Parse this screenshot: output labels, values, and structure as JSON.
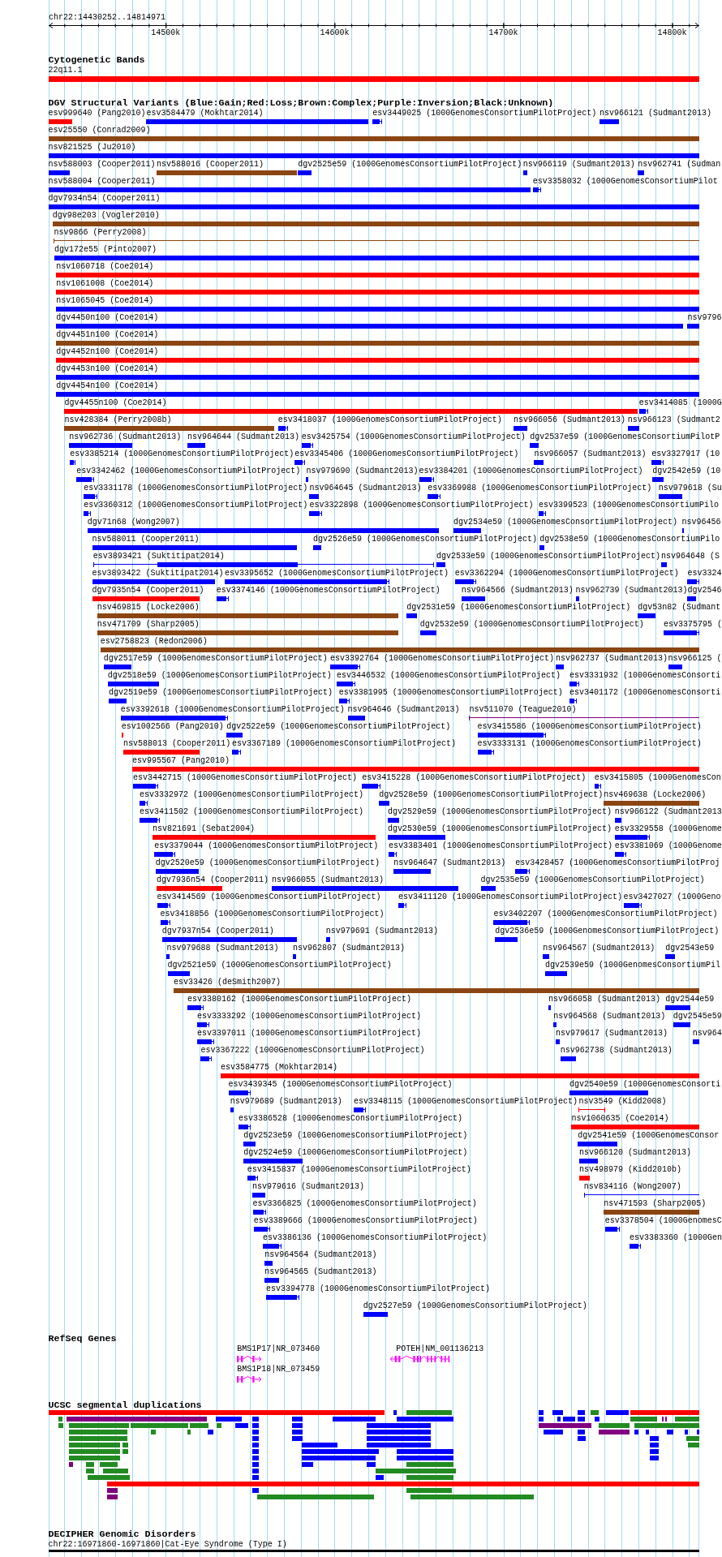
{
  "ruler": {
    "range": "chr22:14430252..14814971",
    "ticks": [
      "14500k",
      "14600k",
      "14700k",
      "14800k"
    ]
  },
  "tracks": [
    {
      "kind": "cytoband",
      "title": "Cytogenetic Bands",
      "bands": [
        {
          "label": "22q11.1"
        }
      ]
    },
    {
      "kind": "variants",
      "title": "DGV Structural Variants (Blue:Gain;Red:Loss;Brown:Complex;Purple:Inversion;Black:Unknown)",
      "rows": [
        {
          "features": [
            {
              "label": "esv999640 (Pang2010)",
              "color": "#ff0000",
              "kind": "solid"
            },
            {
              "label": "esv3584479 (Mokhtar2014)",
              "color": "#0000ff",
              "kind": "solid"
            },
            {
              "label": "esv3449025 (1000GenomesConsortiumPilotProject)",
              "color": "#0000ff",
              "kind": "bracketed"
            },
            {
              "label": "nsv966121 (Sudmant2013)",
              "color": "#0000ff",
              "kind": "solid"
            }
          ]
        },
        {
          "features": [
            {
              "label": "esv25550 (Conrad2009)",
              "color": "#8b4513",
              "kind": "solid"
            }
          ]
        },
        {
          "features": [
            {
              "label": "nsv821525 (Ju2010)",
              "color": "#0000ff",
              "kind": "solid"
            }
          ]
        },
        {
          "features": [
            {
              "label": "nsv588003 (Cooper2011)",
              "color": "#0000ff",
              "kind": "solid"
            },
            {
              "label": "nsv588016 (Cooper2011)",
              "color": "#8b4513",
              "kind": "solid"
            },
            {
              "label": "dgv2525e59 (1000GenomesConsortiumPilotProject)",
              "color": "#0000ff",
              "kind": "solid"
            },
            {
              "label": "nsv966119 (Sudmant2013)",
              "color": "#0000ff",
              "kind": "solid"
            },
            {
              "label": "nsv962741 (Sudman",
              "color": "#0000ff",
              "kind": "solid"
            }
          ]
        },
        {
          "features": [
            {
              "label": "nsv588004 (Cooper2011)",
              "color": "#0000ff",
              "kind": "solid"
            },
            {
              "label": "esv3358032 (1000GenomesConsortiumPilot",
              "color": "#0000ff",
              "kind": "bracketed"
            }
          ]
        },
        {
          "features": [
            {
              "label": "dgv7934n54 (Cooper2011)",
              "color": "#0000ff",
              "kind": "solid"
            }
          ]
        },
        {
          "features": [
            {
              "label": "dgv98e203 (Vogler2010)",
              "color": "#8b4513",
              "kind": "solid"
            }
          ]
        },
        {
          "features": [
            {
              "label": "nsv9866 (Perry2008)",
              "color": "#8b4513",
              "kind": "line"
            }
          ]
        },
        {
          "features": [
            {
              "label": "dgv172e55 (Pinto2007)",
              "color": "#0000ff",
              "kind": "solid"
            }
          ]
        },
        {
          "features": [
            {
              "label": "nsv1060718 (Coe2014)",
              "color": "#ff0000",
              "kind": "solid"
            }
          ]
        },
        {
          "features": [
            {
              "label": "nsv1061008 (Coe2014)",
              "color": "#ff0000",
              "kind": "solid"
            }
          ]
        },
        {
          "features": [
            {
              "label": "nsv1065045 (Coe2014)",
              "color": "#0000ff",
              "kind": "solid"
            }
          ]
        },
        {
          "features": [
            {
              "label": "dgv4450n100 (Coe2014)",
              "color": "#0000ff",
              "kind": "solid"
            },
            {
              "label": "nsv9796",
              "color": "#0000ff",
              "kind": "solid"
            }
          ]
        },
        {
          "features": [
            {
              "label": "dgv4451n100 (Coe2014)",
              "color": "#8b4513",
              "kind": "solid"
            }
          ]
        },
        {
          "features": [
            {
              "label": "dgv4452n100 (Coe2014)",
              "color": "#ff0000",
              "kind": "solid"
            }
          ]
        },
        {
          "features": [
            {
              "label": "dgv4453n100 (Coe2014)",
              "color": "#0000ff",
              "kind": "solid"
            }
          ]
        },
        {
          "features": [
            {
              "label": "dgv4454n100 (Coe2014)",
              "color": "#0000ff",
              "kind": "solid"
            }
          ]
        },
        {
          "features": [
            {
              "label": "dgv4455n100 (Coe2014)",
              "color": "#ff0000",
              "kind": "solid"
            },
            {
              "label": "esv3414085 (1000G",
              "color": "#0000ff",
              "kind": "bracketed"
            }
          ]
        },
        {
          "features": [
            {
              "label": "nsv428384 (Perry2008b)",
              "color": "#8b4513",
              "kind": "solid"
            },
            {
              "label": "esv3418037 (1000GenomesConsortiumPilotProject)",
              "color": "#0000ff",
              "kind": "bracketed"
            },
            {
              "label": "nsv966056 (Sudmant2013)",
              "color": "#0000ff",
              "kind": "solid"
            },
            {
              "label": "nsv966123 (Sudmant2",
              "color": "#0000ff",
              "kind": "solid"
            }
          ]
        },
        {
          "features": [
            {
              "label": "nsv962736 (Sudmant2013)",
              "color": "#0000ff",
              "kind": "solid"
            },
            {
              "label": "nsv964644 (Sudmant2013)",
              "color": "#0000ff",
              "kind": "solid"
            },
            {
              "label": "esv3425754 (1000GenomesConsortiumPilotProject)",
              "color": "#0000ff",
              "kind": "bracketed"
            },
            {
              "label": "dgv2537e59 (1000GenomesConsortiumPilotP",
              "color": "#0000ff",
              "kind": "solid"
            }
          ]
        },
        {
          "features": [
            {
              "label": "esv3385214 (1000GenomesConsortiumPilotProject)",
              "color": "#0000ff",
              "kind": "bracketed"
            },
            {
              "label": "esv3345406 (1000GenomesConsortiumPilotProject)",
              "color": "#0000ff",
              "kind": "bracketed"
            },
            {
              "label": "nsv966057 (Sudmant2013)",
              "color": "#0000ff",
              "kind": "solid"
            },
            {
              "label": "esv3327917 (10",
              "color": "#0000ff",
              "kind": "bracketed"
            }
          ]
        },
        {
          "features": [
            {
              "label": "esv3342462 (1000GenomesConsortiumPilotProject)",
              "color": "#0000ff",
              "kind": "bracketed"
            },
            {
              "label": "nsv979690 (Sudmant2013)",
              "color": "#0000ff",
              "kind": "solid"
            },
            {
              "label": "esv3384201 (1000GenomesConsortiumPilotProject)",
              "color": "#0000ff",
              "kind": "bracketed"
            },
            {
              "label": "dgv2542e59 (10",
              "color": "#0000ff",
              "kind": "solid"
            }
          ]
        },
        {
          "features": [
            {
              "label": "esv3331178 (1000GenomesConsortiumPilotProject)",
              "color": "#0000ff",
              "kind": "bracketed"
            },
            {
              "label": "nsv964645 (Sudmant2013)",
              "color": "#0000ff",
              "kind": "solid"
            },
            {
              "label": "esv3369988 (1000GenomesConsortiumPilotProject)",
              "color": "#0000ff",
              "kind": "bracketed"
            },
            {
              "label": "nsv979618 (Su",
              "color": "#0000ff",
              "kind": "solid"
            }
          ]
        },
        {
          "features": [
            {
              "label": "esv3360312 (1000GenomesConsortiumPilotProject)",
              "color": "#0000ff",
              "kind": "bracketed"
            },
            {
              "label": "esv3322898 (1000GenomesConsortiumPilotProject)",
              "color": "#0000ff",
              "kind": "bracketed"
            },
            {
              "label": "esv3399523 (1000GenomesConsortiumPilo",
              "color": "#0000ff",
              "kind": "bracketed"
            }
          ]
        },
        {
          "features": [
            {
              "label": "dgv71n68 (Wong2007)",
              "color": "#0000ff",
              "kind": "solid"
            },
            {
              "label": "dgv2534e59 (1000GenomesConsortiumPilotProject)",
              "color": "#0000ff",
              "kind": "solid"
            },
            {
              "label": "nsv96456",
              "color": "#0000ff",
              "kind": "solid"
            }
          ]
        },
        {
          "features": [
            {
              "label": "nsv588011 (Cooper2011)",
              "color": "#0000ff",
              "kind": "solid"
            },
            {
              "label": "dgv2526e59 (1000GenomesConsortiumPilotProject)",
              "color": "#0000ff",
              "kind": "solid"
            },
            {
              "label": "dgv2538e59 (1000GenomesConsortiumPilo",
              "color": "#0000ff",
              "kind": "solid"
            }
          ]
        },
        {
          "features": [
            {
              "label": "esv3893421 (Suktitipat2014)",
              "color": "#0000ff",
              "kind": "cored"
            },
            {
              "label": "dgv2533e59 (1000GenomesConsortiumPilotProject)",
              "color": "#0000ff",
              "kind": "solid"
            },
            {
              "label": "nsv964648 (S",
              "color": "#0000ff",
              "kind": "solid"
            }
          ]
        },
        {
          "features": [
            {
              "label": "esv3893422 (Suktitipat2014)",
              "color": "#0000ff",
              "kind": "solid"
            },
            {
              "label": "esv3395652 (1000GenomesConsortiumPilotProject)",
              "color": "#0000ff",
              "kind": "bracketed"
            },
            {
              "label": "esv3362294 (1000GenomesConsortiumPilotProject)",
              "color": "#0000ff",
              "kind": "bracketed"
            },
            {
              "label": "esv3324",
              "color": "#0000ff",
              "kind": "bracketed"
            }
          ]
        },
        {
          "features": [
            {
              "label": "dgv7935n54 (Cooper2011)",
              "color": "#ff0000",
              "kind": "solid"
            },
            {
              "label": "esv3374146 (1000GenomesConsortiumPilotProject)",
              "color": "#0000ff",
              "kind": "bracketed"
            },
            {
              "label": "nsv964566 (Sudmant2013)",
              "color": "#0000ff",
              "kind": "solid"
            },
            {
              "label": "nsv962739 (Sudmant2013)",
              "color": "#0000ff",
              "kind": "solid"
            },
            {
              "label": "dgv2546",
              "color": "#0000ff",
              "kind": "solid"
            }
          ]
        },
        {
          "features": [
            {
              "label": "nsv469815 (Locke2006)",
              "color": "#8b4513",
              "kind": "solid"
            },
            {
              "label": "dgv2531e59 (1000GenomesConsortiumPilotProject)",
              "color": "#0000ff",
              "kind": "solid"
            },
            {
              "label": "dgv53n82 (Sudmant",
              "color": "#0000ff",
              "kind": "solid"
            }
          ]
        },
        {
          "features": [
            {
              "label": "nsv471709 (Sharp2005)",
              "color": "#8b4513",
              "kind": "solid"
            },
            {
              "label": "dgv2532e59 (1000GenomesConsortiumPilotProject)",
              "color": "#0000ff",
              "kind": "solid"
            },
            {
              "label": "esv3375795 (",
              "color": "#0000ff",
              "kind": "bracketed"
            }
          ]
        },
        {
          "features": [
            {
              "label": "esv2758823 (Redon2006)",
              "color": "#8b4513",
              "kind": "solid"
            }
          ]
        },
        {
          "features": [
            {
              "label": "dgv2517e59 (1000GenomesConsortiumPilotProject)",
              "color": "#0000ff",
              "kind": "solid"
            },
            {
              "label": "esv3392764 (1000GenomesConsortiumPilotProject)",
              "color": "#0000ff",
              "kind": "bracketed"
            },
            {
              "label": "nsv962737 (Sudmant2013)",
              "color": "#0000ff",
              "kind": "solid"
            },
            {
              "label": "nsv966125 (",
              "color": "#0000ff",
              "kind": "solid"
            }
          ]
        },
        {
          "features": [
            {
              "label": "dgv2518e59 (1000GenomesConsortiumPilotProject)",
              "color": "#0000ff",
              "kind": "solid"
            },
            {
              "label": "esv3446532 (1000GenomesConsortiumPilotProject)",
              "color": "#0000ff",
              "kind": "bracketed"
            },
            {
              "label": "esv3331932 (1000GenomesConsorti",
              "color": "#0000ff",
              "kind": "bracketed"
            }
          ]
        },
        {
          "features": [
            {
              "label": "dgv2519e59 (1000GenomesConsortiumPilotProject)",
              "color": "#0000ff",
              "kind": "solid"
            },
            {
              "label": "esv3381995 (1000GenomesConsortiumPilotProject)",
              "color": "#0000ff",
              "kind": "bracketed"
            },
            {
              "label": "esv3401172 (1000GenomesConsorti",
              "color": "#0000ff",
              "kind": "bracketed"
            }
          ]
        },
        {
          "features": [
            {
              "label": "esv3392618 (1000GenomesConsortiumPilotProject)",
              "color": "#0000ff",
              "kind": "bracketed"
            },
            {
              "label": "nsv964646 (Sudmant2013)",
              "color": "#0000ff",
              "kind": "solid"
            },
            {
              "label": "nsv511070 (Teague2010)",
              "color": "#800080",
              "kind": "line"
            }
          ]
        },
        {
          "features": [
            {
              "label": "esv1002566 (Pang2010)",
              "color": "#ff0000",
              "kind": "solid"
            },
            {
              "label": "dgv2522e59 (1000GenomesConsortiumPilotProject)",
              "color": "#0000ff",
              "kind": "solid"
            },
            {
              "label": "esv3415586 (1000GenomesConsortiumPilotProject)",
              "color": "#0000ff",
              "kind": "bracketed"
            }
          ]
        },
        {
          "features": [
            {
              "label": "nsv588013 (Cooper2011)",
              "color": "#ff0000",
              "kind": "solid"
            },
            {
              "label": "esv3367189 (1000GenomesConsortiumPilotProject)",
              "color": "#0000ff",
              "kind": "bracketed"
            },
            {
              "label": "esv3333131 (1000GenomesConsortiumPilotProject)",
              "color": "#0000ff",
              "kind": "bracketed"
            }
          ]
        },
        {
          "features": [
            {
              "label": "esv995567 (Pang2010)",
              "color": "#ff0000",
              "kind": "solid"
            }
          ]
        },
        {
          "features": [
            {
              "label": "esv3442715 (1000GenomesConsortiumPilotProject)",
              "color": "#0000ff",
              "kind": "bracketed"
            },
            {
              "label": "esv3415228 (1000GenomesConsortiumPilotProject)",
              "color": "#0000ff",
              "kind": "bracketed"
            },
            {
              "label": "esv3415805 (1000GenomesCon",
              "color": "#0000ff",
              "kind": "bracketed"
            }
          ]
        },
        {
          "features": [
            {
              "label": "esv3332972 (1000GenomesConsortiumPilotProject)",
              "color": "#0000ff",
              "kind": "bracketed"
            },
            {
              "label": "dgv2528e59 (1000GenomesConsortiumPilotProject)",
              "color": "#0000ff",
              "kind": "solid"
            },
            {
              "label": "nsv469638 (Locke2006)",
              "color": "#8b4513",
              "kind": "solid"
            }
          ]
        },
        {
          "features": [
            {
              "label": "esv3411502 (1000GenomesConsortiumPilotProject)",
              "color": "#0000ff",
              "kind": "bracketed"
            },
            {
              "label": "dgv2529e59 (1000GenomesConsortiumPilotProject)",
              "color": "#0000ff",
              "kind": "solid"
            },
            {
              "label": "nsv966122 (Sudmant2013",
              "color": "#0000ff",
              "kind": "solid"
            }
          ]
        },
        {
          "features": [
            {
              "label": "nsv821691 (Sebat2004)",
              "color": "#ff0000",
              "kind": "solid"
            },
            {
              "label": "dgv2530e59 (1000GenomesConsortiumPilotProject)",
              "color": "#0000ff",
              "kind": "solid"
            },
            {
              "label": "esv3329558 (1000Genome",
              "color": "#0000ff",
              "kind": "bracketed"
            }
          ]
        },
        {
          "features": [
            {
              "label": "esv3379044 (1000GenomesConsortiumPilotProject)",
              "color": "#0000ff",
              "kind": "bracketed"
            },
            {
              "label": "esv3383401 (1000GenomesConsortiumPilotProject)",
              "color": "#0000ff",
              "kind": "bracketed"
            },
            {
              "label": "esv3381069 (1000Genome",
              "color": "#0000ff",
              "kind": "bracketed"
            }
          ]
        },
        {
          "features": [
            {
              "label": "dgv2520e59 (1000GenomesConsortiumPilotProject)",
              "color": "#0000ff",
              "kind": "solid"
            },
            {
              "label": "nsv964647 (Sudmant2013)",
              "color": "#0000ff",
              "kind": "solid"
            },
            {
              "label": "esv3428457 (1000GenomesConsortiumPilotProj",
              "color": "#0000ff",
              "kind": "bracketed"
            }
          ]
        },
        {
          "features": [
            {
              "label": "dgv7936n54 (Cooper2011)",
              "color": "#ff0000",
              "kind": "solid"
            },
            {
              "label": "nsv966055 (Sudmant2013)",
              "color": "#0000ff",
              "kind": "solid"
            },
            {
              "label": "dgv2535e59 (1000GenomesConsortiumPilotProject)",
              "color": "#0000ff",
              "kind": "solid"
            }
          ]
        },
        {
          "features": [
            {
              "label": "esv3414569 (1000GenomesConsortiumPilotProject)",
              "color": "#0000ff",
              "kind": "bracketed"
            },
            {
              "label": "esv3411120 (1000GenomesConsortiumPilotProject)",
              "color": "#0000ff",
              "kind": "bracketed"
            },
            {
              "label": "esv3427027 (1000Geno",
              "color": "#0000ff",
              "kind": "bracketed"
            }
          ]
        },
        {
          "features": [
            {
              "label": "esv3418856 (1000GenomesConsortiumPilotProject)",
              "color": "#0000ff",
              "kind": "bracketed"
            },
            {
              "label": "esv3402207 (1000GenomesConsortiumPilotProject)",
              "color": "#0000ff",
              "kind": "bracketed"
            }
          ]
        },
        {
          "features": [
            {
              "label": "dgv7937n54 (Cooper2011)",
              "color": "#0000ff",
              "kind": "solid"
            },
            {
              "label": "nsv979691 (Sudmant2013)",
              "color": "#0000ff",
              "kind": "solid"
            },
            {
              "label": "dgv2536e59 (1000GenomesConsortiumPilotProject)",
              "color": "#0000ff",
              "kind": "solid"
            }
          ]
        },
        {
          "features": [
            {
              "label": "nsv979688 (Sudmant2013)",
              "color": "#0000ff",
              "kind": "solid"
            },
            {
              "label": "nsv962807 (Sudmant2013)",
              "color": "#0000ff",
              "kind": "solid"
            },
            {
              "label": "nsv964567 (Sudmant2013)",
              "color": "#0000ff",
              "kind": "solid"
            },
            {
              "label": "dgv2543e59",
              "color": "#0000ff",
              "kind": "solid"
            }
          ]
        },
        {
          "features": [
            {
              "label": "dgv2521e59 (1000GenomesConsortiumPilotProject)",
              "color": "#0000ff",
              "kind": "solid"
            },
            {
              "label": "dgv2539e59 (1000GenomesConsortiumPil",
              "color": "#0000ff",
              "kind": "solid"
            }
          ]
        },
        {
          "features": [
            {
              "label": "esv33426 (deSmith2007)",
              "color": "#8b4513",
              "kind": "solid"
            }
          ]
        },
        {
          "features": [
            {
              "label": "esv3380162 (1000GenomesConsortiumPilotProject)",
              "color": "#0000ff",
              "kind": "bracketed"
            },
            {
              "label": "nsv966058 (Sudmant2013)",
              "color": "#0000ff",
              "kind": "solid"
            },
            {
              "label": "dgv2544e59",
              "color": "#0000ff",
              "kind": "solid"
            }
          ]
        },
        {
          "features": [
            {
              "label": "esv3333292 (1000GenomesConsortiumPilotProject)",
              "color": "#0000ff",
              "kind": "bracketed"
            },
            {
              "label": "nsv964568 (Sudmant2013)",
              "color": "#0000ff",
              "kind": "solid"
            },
            {
              "label": "dgv2545e59",
              "color": "#0000ff",
              "kind": "solid"
            }
          ]
        },
        {
          "features": [
            {
              "label": "esv3397011 (1000GenomesConsortiumPilotProject)",
              "color": "#0000ff",
              "kind": "bracketed"
            },
            {
              "label": "nsv979617 (Sudmant2013)",
              "color": "#0000ff",
              "kind": "solid"
            },
            {
              "label": "nsv964",
              "color": "#0000ff",
              "kind": "solid"
            }
          ]
        },
        {
          "features": [
            {
              "label": "esv3367222 (1000GenomesConsortiumPilotProject)",
              "color": "#0000ff",
              "kind": "bracketed"
            },
            {
              "label": "nsv962738 (Sudmant2013)",
              "color": "#0000ff",
              "kind": "solid"
            }
          ]
        },
        {
          "features": [
            {
              "label": "esv3584775 (Mokhtar2014)",
              "color": "#ff0000",
              "kind": "solid"
            }
          ]
        },
        {
          "features": [
            {
              "label": "esv3439345 (1000GenomesConsortiumPilotProject)",
              "color": "#0000ff",
              "kind": "bracketed"
            },
            {
              "label": "dgv2540e59 (1000GenomesConsorti",
              "color": "#0000ff",
              "kind": "solid"
            }
          ]
        },
        {
          "features": [
            {
              "label": "nsv979689 (Sudmant2013)",
              "color": "#0000ff",
              "kind": "solid"
            },
            {
              "label": "esv3348115 (1000GenomesConsortiumPilotProject)",
              "color": "#0000ff",
              "kind": "bracketed"
            },
            {
              "label": "nsv3549 (Kidd2008)",
              "color": "#ff0000",
              "kind": "line"
            }
          ]
        },
        {
          "features": [
            {
              "label": "esv3386528 (1000GenomesConsortiumPilotProject)",
              "color": "#0000ff",
              "kind": "bracketed"
            },
            {
              "label": "nsv1060635 (Coe2014)",
              "color": "#ff0000",
              "kind": "solid"
            }
          ]
        },
        {
          "features": [
            {
              "label": "dgv2523e59 (1000GenomesConsortiumPilotProject)",
              "color": "#0000ff",
              "kind": "solid"
            },
            {
              "label": "dgv2541e59 (1000GenomesConsor",
              "color": "#0000ff",
              "kind": "solid"
            }
          ]
        },
        {
          "features": [
            {
              "label": "dgv2524e59 (1000GenomesConsortiumPilotProject)",
              "color": "#0000ff",
              "kind": "solid"
            },
            {
              "label": "nsv966120 (Sudmant2013)",
              "color": "#0000ff",
              "kind": "solid"
            }
          ]
        },
        {
          "features": [
            {
              "label": "esv3415837 (1000GenomesConsortiumPilotProject)",
              "color": "#0000ff",
              "kind": "bracketed"
            },
            {
              "label": "nsv498979 (Kidd2010b)",
              "color": "#ff0000",
              "kind": "solid"
            }
          ]
        },
        {
          "features": [
            {
              "label": "nsv979616 (Sudmant2013)",
              "color": "#0000ff",
              "kind": "solid"
            },
            {
              "label": "nsv834116 (Wong2007)",
              "color": "#0000ff",
              "kind": "line"
            }
          ]
        },
        {
          "features": [
            {
              "label": "esv3366825 (1000GenomesConsortiumPilotProject)",
              "color": "#0000ff",
              "kind": "bracketed"
            },
            {
              "label": "nsv471593 (Sharp2005)",
              "color": "#8b4513",
              "kind": "solid"
            }
          ]
        },
        {
          "features": [
            {
              "label": "esv3389666 (1000GenomesConsortiumPilotProject)",
              "color": "#0000ff",
              "kind": "bracketed"
            },
            {
              "label": "esv3378504 (1000GenomesC",
              "color": "#0000ff",
              "kind": "bracketed"
            }
          ]
        },
        {
          "features": [
            {
              "label": "esv3386136 (1000GenomesConsortiumPilotProject)",
              "color": "#0000ff",
              "kind": "bracketed"
            },
            {
              "label": "esv3383360 (1000Gen",
              "color": "#0000ff",
              "kind": "bracketed"
            }
          ]
        },
        {
          "features": [
            {
              "label": "nsv964564 (Sudmant2013)",
              "color": "#0000ff",
              "kind": "solid"
            }
          ]
        },
        {
          "features": [
            {
              "label": "nsv964565 (Sudmant2013)",
              "color": "#0000ff",
              "kind": "solid"
            }
          ]
        },
        {
          "features": [
            {
              "label": "esv3394778 (1000GenomesConsortiumPilotProject)",
              "color": "#0000ff",
              "kind": "bracketed"
            }
          ]
        },
        {
          "features": [
            {
              "label": "dgv2527e59 (1000GenomesConsortiumPilotProject)",
              "color": "#0000ff",
              "kind": "solid"
            }
          ]
        }
      ]
    },
    {
      "kind": "genes",
      "title": "RefSeq Genes",
      "rows": [
        {
          "genes": [
            {
              "label": "BMS1P17|NR_073460",
              "reverse": false
            },
            {
              "label": "POTEH|NM_001136213",
              "reverse": true
            }
          ]
        },
        {
          "genes": [
            {
              "label": "BMS1P18|NR_073459",
              "reverse": false
            }
          ]
        }
      ]
    },
    {
      "kind": "segdups",
      "title": "UCSC segmental duplications",
      "rows": [
        {
          "bars": [
            {
              "color": "#ff0000"
            },
            {
              "color": "#0000ff"
            },
            {
              "color": "#228b22"
            },
            {
              "color": "#0000ff"
            },
            {
              "color": "#0000ff"
            },
            {
              "color": "#0000ff"
            },
            {
              "color": "#228b22"
            },
            {
              "color": "#0000ff"
            },
            {
              "color": "#ff0000"
            }
          ]
        },
        {
          "bars": [
            {
              "color": "#228b22"
            },
            {
              "color": "#800080"
            },
            {
              "color": "#0000ff"
            },
            {
              "color": "#0000ff"
            },
            {
              "color": "#0000ff"
            },
            {
              "color": "#0000ff"
            },
            {
              "color": "#0000ff"
            },
            {
              "color": "#0000ff"
            },
            {
              "color": "#0000ff"
            },
            {
              "color": "#0000ff"
            },
            {
              "color": "#0000ff"
            },
            {
              "color": "#0000ff"
            },
            {
              "color": "#228b22"
            },
            {
              "color": "#800080"
            },
            {
              "color": "#800080"
            },
            {
              "color": "#228b22"
            }
          ]
        },
        {
          "bars": [
            {
              "color": "#228b22"
            },
            {
              "color": "#228b22"
            },
            {
              "color": "#228b22"
            },
            {
              "color": "#228b22"
            },
            {
              "color": "#228b22"
            },
            {
              "color": "#0000ff"
            },
            {
              "color": "#0000ff"
            },
            {
              "color": "#0000ff"
            },
            {
              "color": "#0000ff"
            },
            {
              "color": "#800080"
            },
            {
              "color": "#228b22"
            },
            {
              "color": "#228b22"
            }
          ]
        },
        {
          "bars": [
            {
              "color": "#228b22"
            },
            {
              "color": "#228b22"
            },
            {
              "color": "#228b22"
            },
            {
              "color": "#0000ff"
            },
            {
              "color": "#0000ff"
            },
            {
              "color": "#0000ff"
            },
            {
              "color": "#0000ff"
            },
            {
              "color": "#0000ff"
            },
            {
              "color": "#0000ff"
            },
            {
              "color": "#800080"
            },
            {
              "color": "#0000ff"
            },
            {
              "color": "#0000ff"
            },
            {
              "color": "#0000ff"
            },
            {
              "color": "#0000ff"
            },
            {
              "color": "#0000ff"
            }
          ]
        },
        {
          "bars": [
            {
              "color": "#228b22"
            },
            {
              "color": "#0000ff"
            },
            {
              "color": "#0000ff"
            },
            {
              "color": "#0000ff"
            },
            {
              "color": "#0000ff"
            },
            {
              "color": "#0000ff"
            },
            {
              "color": "#228b22"
            }
          ]
        },
        {
          "bars": [
            {
              "color": "#228b22"
            },
            {
              "color": "#228b22"
            },
            {
              "color": "#0000ff"
            },
            {
              "color": "#0000ff"
            },
            {
              "color": "#0000ff"
            },
            {
              "color": "#0000ff"
            },
            {
              "color": "#228b22"
            }
          ]
        },
        {
          "bars": [
            {
              "color": "#228b22"
            },
            {
              "color": "#228b22"
            },
            {
              "color": "#0000ff"
            },
            {
              "color": "#0000ff"
            },
            {
              "color": "#0000ff"
            },
            {
              "color": "#0000ff"
            }
          ]
        },
        {
          "bars": [
            {
              "color": "#228b22"
            },
            {
              "color": "#0000ff"
            },
            {
              "color": "#0000ff"
            },
            {
              "color": "#0000ff"
            },
            {
              "color": "#0000ff"
            }
          ]
        },
        {
          "bars": [
            {
              "color": "#800080"
            },
            {
              "color": "#228b22"
            },
            {
              "color": "#228b22"
            },
            {
              "color": "#0000ff"
            },
            {
              "color": "#0000ff"
            },
            {
              "color": "#0000ff"
            },
            {
              "color": "#228b22"
            }
          ]
        },
        {
          "bars": [
            {
              "color": "#228b22"
            },
            {
              "color": "#228b22"
            },
            {
              "color": "#0000ff"
            },
            {
              "color": "#228b22"
            }
          ]
        },
        {
          "bars": [
            {
              "color": "#228b22"
            },
            {
              "color": "#0000ff"
            },
            {
              "color": "#0000ff"
            },
            {
              "color": "#228b22"
            }
          ]
        },
        {
          "bars": [
            {
              "color": "#ff0000"
            }
          ]
        },
        {
          "bars": [
            {
              "color": "#800080"
            },
            {
              "color": "#0000ff"
            },
            {
              "color": "#228b22"
            }
          ]
        },
        {
          "bars": [
            {
              "color": "#800080"
            },
            {
              "color": "#228b22"
            },
            {
              "color": "#228b22"
            }
          ]
        }
      ]
    },
    {
      "kind": "disorders",
      "title": "DECIPHER Genomic Disorders",
      "items": [
        {
          "label": "chr22:16971860-16971860|Cat-Eye Syndrome (Type I)"
        }
      ]
    }
  ]
}
